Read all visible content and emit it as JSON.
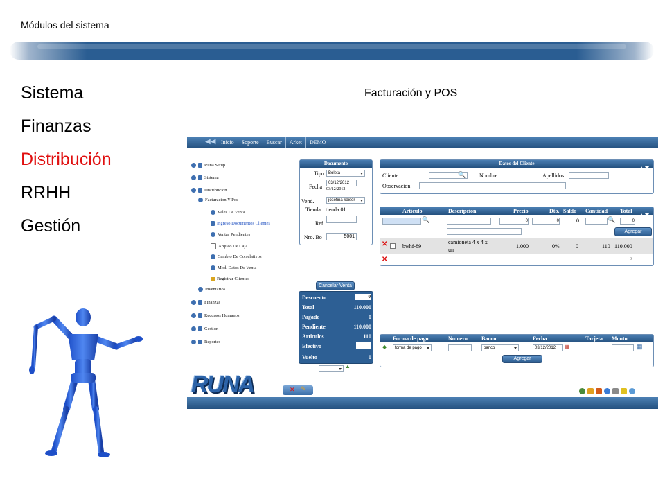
{
  "slide": {
    "header": "Módulos del sistema",
    "screen_title": "Facturación y POS",
    "menu": [
      {
        "label": "Sistema",
        "color": "#000000"
      },
      {
        "label": "Finanzas",
        "color": "#000000"
      },
      {
        "label": "Distribución",
        "color": "#e01010"
      },
      {
        "label": "RRHH",
        "color": "#000000"
      },
      {
        "label": "Gestión",
        "color": "#000000"
      }
    ]
  },
  "app": {
    "nav": [
      "Inicio",
      "Soporte",
      "Buscar",
      "Arket",
      "DEMO"
    ],
    "tree": [
      "Runa Setup",
      "Sistema",
      "Distribucion",
      "Facturacion Y Pos",
      "Vales De Venta",
      "Ingreso Documentos Clientes",
      "Ventas Pendientes",
      "Arqueo De Caja",
      "Cambio De Correlativos",
      "Mod. Datos De Venta",
      "Registrar Clientes",
      "Inventarios",
      "Finanzas",
      "Recursos Humanos",
      "Gestion",
      "Reportes"
    ],
    "documento": {
      "title": "Documento",
      "tipo_label": "Tipo",
      "tipo_value": "Boleta",
      "fecha_label": "Fecha",
      "fecha_value1": "03/12/2012",
      "fecha_value2": "03/12/2012",
      "vend_label": "Vend.",
      "vend_value": "josefina kaiser",
      "tienda_label": "Tienda",
      "tienda_value": "tienda 01",
      "ref_label": "Ref",
      "nrobo_label": "Nro. Bo",
      "nrobo_value": "5001"
    },
    "cliente": {
      "title": "Datos del Cliente",
      "cliente_label": "Cliente",
      "nombre_label": "Nombre",
      "apellidos_label": "Apellidos",
      "observacion_label": "Observacion"
    },
    "articulos": {
      "headers": [
        "Articulo",
        "Descripcion",
        "Precio",
        "Dto.",
        "Saldo",
        "Cantidad",
        "Total"
      ],
      "input_row": {
        "precio": "0",
        "dto": "0",
        "saldo": "0",
        "total": "0"
      },
      "agregar": "Agregar",
      "item": {
        "articulo": "bwhf-89",
        "descripcion_1": "camioneta 4 x 4 x",
        "descripcion_2": "un",
        "precio": "1.000",
        "dto": "0%",
        "saldo": "0",
        "cantidad": "110",
        "total": "110.000"
      },
      "footer_total": "0"
    },
    "resumen": {
      "cancelar": "Cancelar Venta",
      "rows": [
        {
          "label": "Descuento",
          "value": "0"
        },
        {
          "label": "Total",
          "value": "110.000"
        },
        {
          "label": "Pagado",
          "value": "0"
        },
        {
          "label": "Pendiente",
          "value": "110.000"
        },
        {
          "label": "Articulos",
          "value": "110"
        },
        {
          "label": "Efectivo",
          "value": ""
        },
        {
          "label": "Vuelto",
          "value": "0"
        }
      ]
    },
    "pago": {
      "headers": [
        "Forma de pago",
        "Numero",
        "Banco",
        "Fecha",
        "Tarjeta",
        "Monto"
      ],
      "forma_value": "forma de pago",
      "banco_value": "banco",
      "fecha_value": "03/12/2012",
      "agregar": "Agregar"
    },
    "logo": "RUNA",
    "colors": {
      "header_blue": "#2a5d92",
      "accent_red": "#e01010"
    }
  }
}
